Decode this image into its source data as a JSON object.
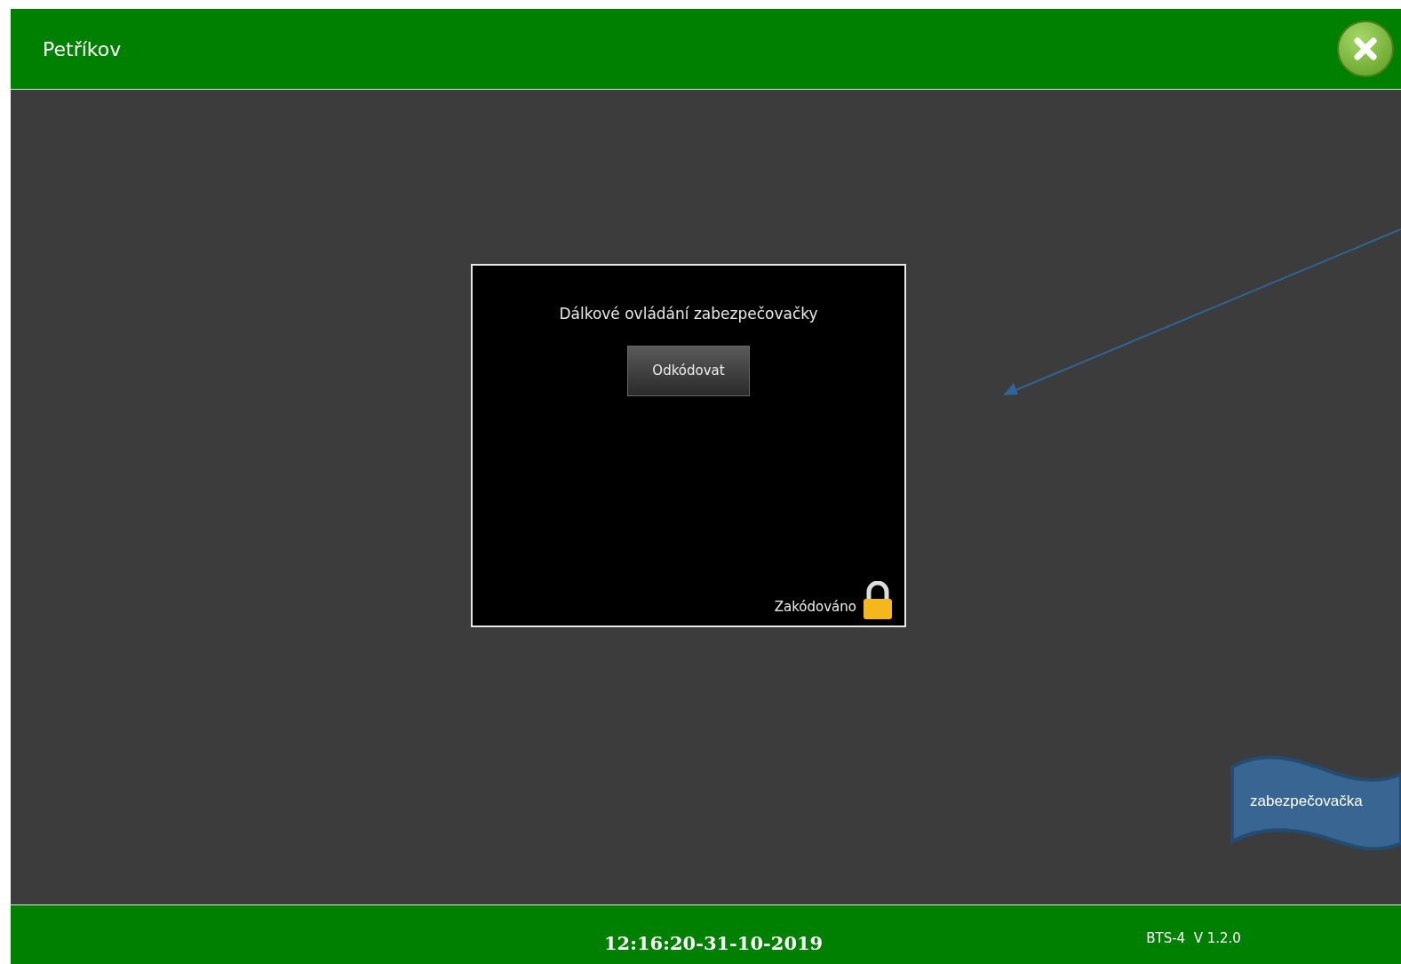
{
  "header": {
    "title": "Petříkov"
  },
  "panel": {
    "title": "Dálkové ovládání zabezpečovačky",
    "button": "Odkódovat",
    "status": "Zakódováno",
    "locked": true
  },
  "annotation": {
    "label": "zabezpečovačka"
  },
  "footer": {
    "datetime": "12:16:20-31-10-2019",
    "version": "BTS-4  V 1.2.0"
  }
}
